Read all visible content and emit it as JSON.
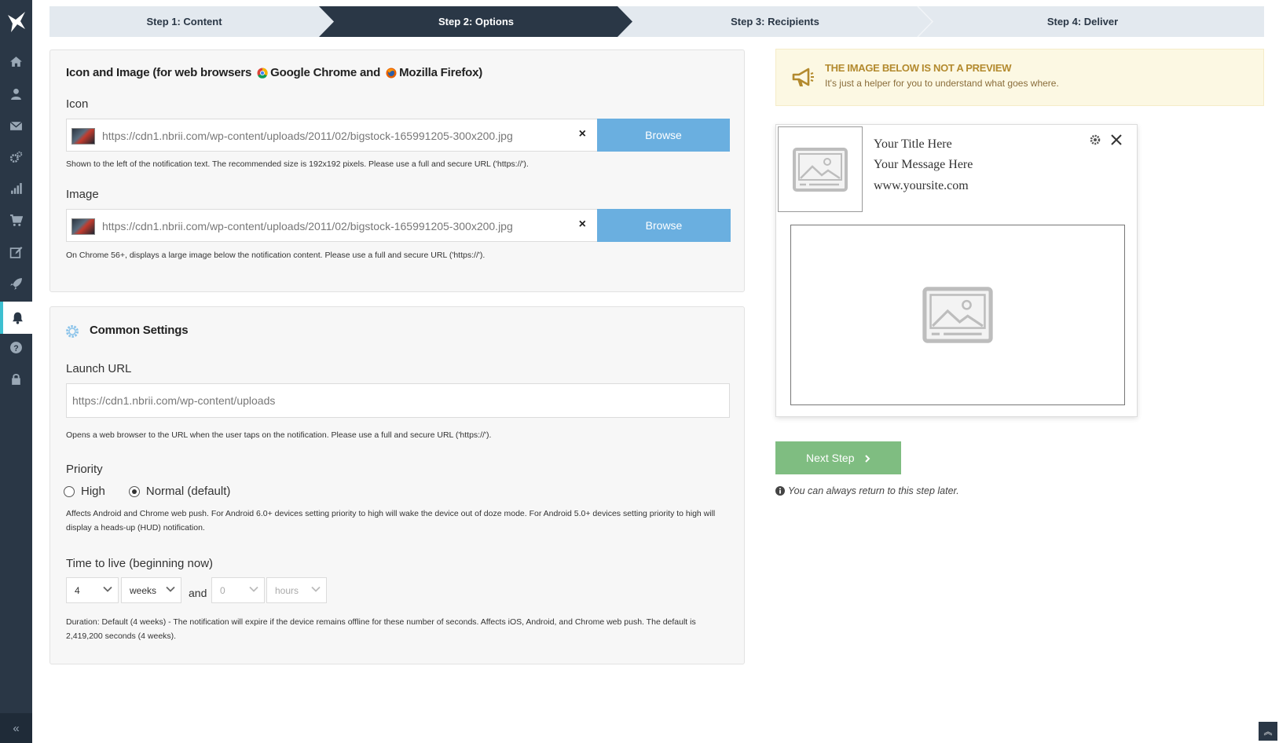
{
  "steps": [
    {
      "label": "Step 1: Content",
      "active": false
    },
    {
      "label": "Step 2: Options",
      "active": true
    },
    {
      "label": "Step 3: Recipients",
      "active": false
    },
    {
      "label": "Step 4: Deliver",
      "active": false
    }
  ],
  "colors": {
    "sidebar": "#2a3746",
    "active_step": "#2a3746",
    "browse": "#6aafe0",
    "next": "#7fbd81",
    "active_accent": "#3dbfd0",
    "notice_title": "#b38a2e"
  },
  "sidebar": {
    "items": [
      {
        "icon": "home-icon"
      },
      {
        "icon": "user-icon"
      },
      {
        "icon": "envelope-icon"
      },
      {
        "icon": "gears-icon"
      },
      {
        "icon": "bar-chart-icon"
      },
      {
        "icon": "cart-icon"
      },
      {
        "icon": "edit-icon"
      },
      {
        "icon": "rocket-icon"
      },
      {
        "icon": "bell-icon",
        "active": true
      },
      {
        "icon": "question-icon"
      },
      {
        "icon": "lock-icon"
      }
    ],
    "collapse_label": "«"
  },
  "icon_image": {
    "title_prefix": "Icon and Image (for web browsers",
    "browser1": "Google Chrome and",
    "browser2": "Mozilla Firefox)",
    "icon_label": "Icon",
    "icon_url": "https://cdn1.nbrii.com/wp-content/uploads/2011/02/bigstock-165991205-300x200.jpg",
    "icon_help": "Shown to the left of the notification text. The recommended size is 192x192 pixels. Please use a full and secure URL ('https://').",
    "image_label": "Image",
    "image_url": "https://cdn1.nbrii.com/wp-content/uploads/2011/02/bigstock-165991205-300x200.jpg",
    "image_help": "On Chrome 56+, displays a large image below the notification content. Please use a full and secure URL ('https://').",
    "browse_label": "Browse",
    "clear_label": "×"
  },
  "common": {
    "title": "Common Settings",
    "launch_label": "Launch URL",
    "launch_url": "https://cdn1.nbrii.com/wp-content/uploads",
    "launch_help": "Opens a web browser to the URL when the user taps on the notification. Please use a full and secure URL ('https://').",
    "priority_label": "Priority",
    "priority_high": "High",
    "priority_normal": "Normal (default)",
    "priority_help": "Affects Android and Chrome web push. For Android 6.0+ devices setting priority to high will wake the device out of doze mode. For Android 5.0+ devices setting priority to high will display a heads-up (HUD) notification.",
    "ttl_label": "Time to live (beginning now)",
    "ttl_value1": "4",
    "ttl_unit1": "weeks",
    "ttl_and": "and",
    "ttl_value2": "0",
    "ttl_unit2": "hours",
    "ttl_help": "Duration: Default (4 weeks) - The notification will expire if the device remains offline for these number of seconds. Affects iOS, Android, and Chrome web push. The default is 2,419,200 seconds (4 weeks)."
  },
  "notice": {
    "title": "THE IMAGE BELOW IS NOT A PREVIEW",
    "text": "It's just a helper for you to understand what goes where."
  },
  "preview": {
    "title": "Your Title Here",
    "message": "Your Message Here",
    "site": "www.yoursite.com"
  },
  "next_step_label": "Next Step",
  "hint": "You can always return to this step later.",
  "scroll_top_label": "︽"
}
